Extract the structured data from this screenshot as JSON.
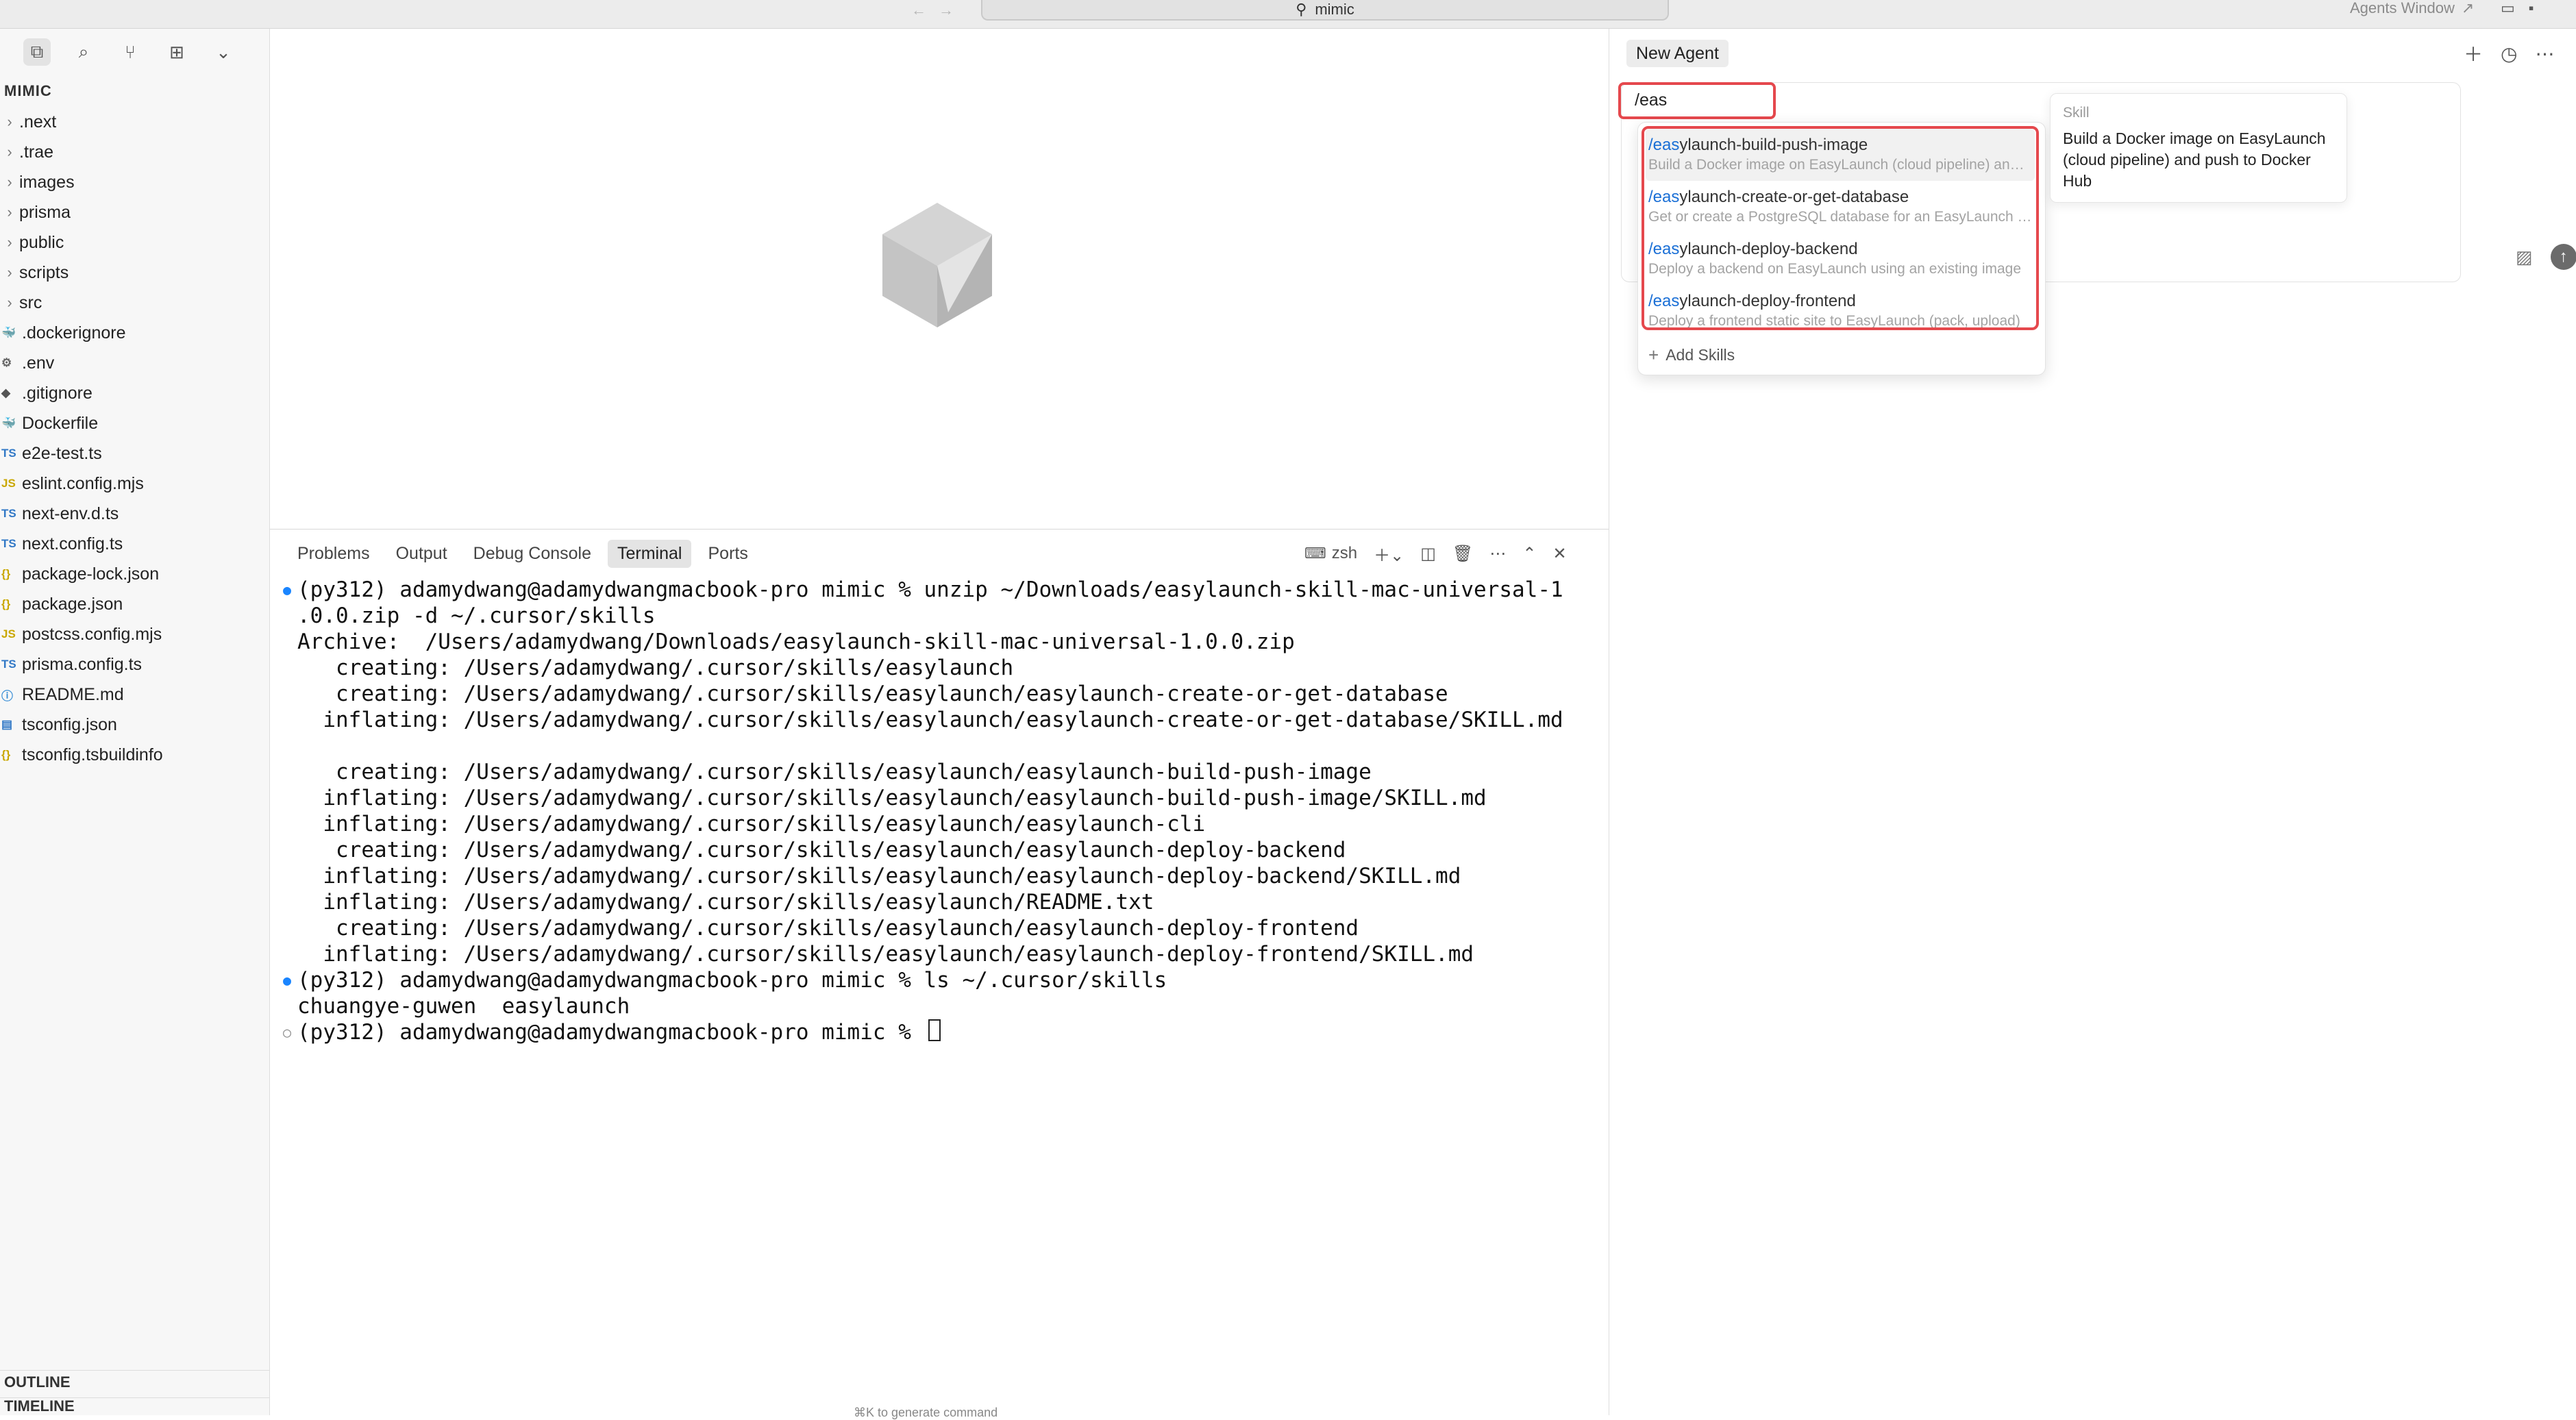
{
  "window": {
    "title": "mimic",
    "agents_window": "Agents Window"
  },
  "sidebar": {
    "title": "MIMIC",
    "tools": [
      "explorer-icon",
      "search-icon",
      "source-control-icon",
      "extensions-icon",
      "chevron-down-icon"
    ],
    "items": [
      {
        "label": ".next",
        "type": "folder"
      },
      {
        "label": ".trae",
        "type": "folder"
      },
      {
        "label": "images",
        "type": "folder"
      },
      {
        "label": "prisma",
        "type": "folder"
      },
      {
        "label": "public",
        "type": "folder"
      },
      {
        "label": "scripts",
        "type": "folder"
      },
      {
        "label": "src",
        "type": "folder"
      },
      {
        "label": ".dockerignore",
        "type": "docker"
      },
      {
        "label": ".env",
        "type": "gear"
      },
      {
        "label": ".gitignore",
        "type": "git"
      },
      {
        "label": "Dockerfile",
        "type": "docker"
      },
      {
        "label": "e2e-test.ts",
        "type": "ts"
      },
      {
        "label": "eslint.config.mjs",
        "type": "js"
      },
      {
        "label": "next-env.d.ts",
        "type": "ts"
      },
      {
        "label": "next.config.ts",
        "type": "ts"
      },
      {
        "label": "package-lock.json",
        "type": "json"
      },
      {
        "label": "package.json",
        "type": "json"
      },
      {
        "label": "postcss.config.mjs",
        "type": "js"
      },
      {
        "label": "prisma.config.ts",
        "type": "ts"
      },
      {
        "label": "README.md",
        "type": "info"
      },
      {
        "label": "tsconfig.json",
        "type": "tsconfig"
      },
      {
        "label": "tsconfig.tsbuildinfo",
        "type": "json"
      }
    ],
    "outline": "OUTLINE",
    "timeline": "TIMELINE"
  },
  "panel": {
    "tabs": [
      "Problems",
      "Output",
      "Debug Console",
      "Terminal",
      "Ports"
    ],
    "active_tab": "Terminal",
    "shell": "zsh",
    "terminal_lines": [
      {
        "marker": "blue",
        "text": "(py312) adamydwang@adamydwangmacbook-pro mimic % unzip ~/Downloads/easylaunch-skill-mac-universal-1"
      },
      {
        "marker": "",
        "text": ".0.0.zip -d ~/.cursor/skills"
      },
      {
        "marker": "",
        "text": "Archive:  /Users/adamydwang/Downloads/easylaunch-skill-mac-universal-1.0.0.zip"
      },
      {
        "marker": "",
        "text": "   creating: /Users/adamydwang/.cursor/skills/easylaunch"
      },
      {
        "marker": "",
        "text": "   creating: /Users/adamydwang/.cursor/skills/easylaunch/easylaunch-create-or-get-database"
      },
      {
        "marker": "",
        "text": "  inflating: /Users/adamydwang/.cursor/skills/easylaunch/easylaunch-create-or-get-database/SKILL.md"
      },
      {
        "marker": "",
        "text": " "
      },
      {
        "marker": "",
        "text": "   creating: /Users/adamydwang/.cursor/skills/easylaunch/easylaunch-build-push-image"
      },
      {
        "marker": "",
        "text": "  inflating: /Users/adamydwang/.cursor/skills/easylaunch/easylaunch-build-push-image/SKILL.md"
      },
      {
        "marker": "",
        "text": "  inflating: /Users/adamydwang/.cursor/skills/easylaunch/easylaunch-cli"
      },
      {
        "marker": "",
        "text": "   creating: /Users/adamydwang/.cursor/skills/easylaunch/easylaunch-deploy-backend"
      },
      {
        "marker": "",
        "text": "  inflating: /Users/adamydwang/.cursor/skills/easylaunch/easylaunch-deploy-backend/SKILL.md"
      },
      {
        "marker": "",
        "text": "  inflating: /Users/adamydwang/.cursor/skills/easylaunch/README.txt"
      },
      {
        "marker": "",
        "text": "   creating: /Users/adamydwang/.cursor/skills/easylaunch/easylaunch-deploy-frontend"
      },
      {
        "marker": "",
        "text": "  inflating: /Users/adamydwang/.cursor/skills/easylaunch/easylaunch-deploy-frontend/SKILL.md"
      },
      {
        "marker": "blue",
        "text": "(py312) adamydwang@adamydwangmacbook-pro mimic % ls ~/.cursor/skills"
      },
      {
        "marker": "",
        "text": "chuangye-guwen  easylaunch"
      },
      {
        "marker": "hollow",
        "text": "(py312) adamydwang@adamydwangmacbook-pro mimic % ",
        "cursor": true
      }
    ],
    "hint": "⌘K to generate command"
  },
  "agent": {
    "tab_label": "New Agent",
    "input_value": "/eas",
    "skills": [
      {
        "prefix": "/eas",
        "rest": "ylaunch-build-push-image",
        "desc": "Build a Docker image on EasyLaunch (cloud pipeline) and push to Docker Hub"
      },
      {
        "prefix": "/eas",
        "rest": "ylaunch-create-or-get-database",
        "desc": "Get or create a PostgreSQL database for an EasyLaunch project"
      },
      {
        "prefix": "/eas",
        "rest": "ylaunch-deploy-backend",
        "desc": "Deploy a backend on EasyLaunch using an existing image"
      },
      {
        "prefix": "/eas",
        "rest": "ylaunch-deploy-frontend",
        "desc": "Deploy a frontend static site to EasyLaunch (pack, upload)"
      }
    ],
    "add_skills": "Add Skills",
    "preview": {
      "kind": "Skill",
      "text": "Build a Docker image on EasyLaunch (cloud pipeline) and push to Docker Hub"
    }
  },
  "colors": {
    "accent_blue": "#1a6fd6",
    "highlight_red": "#e5484d",
    "terminal_dot": "#1a85ff"
  }
}
